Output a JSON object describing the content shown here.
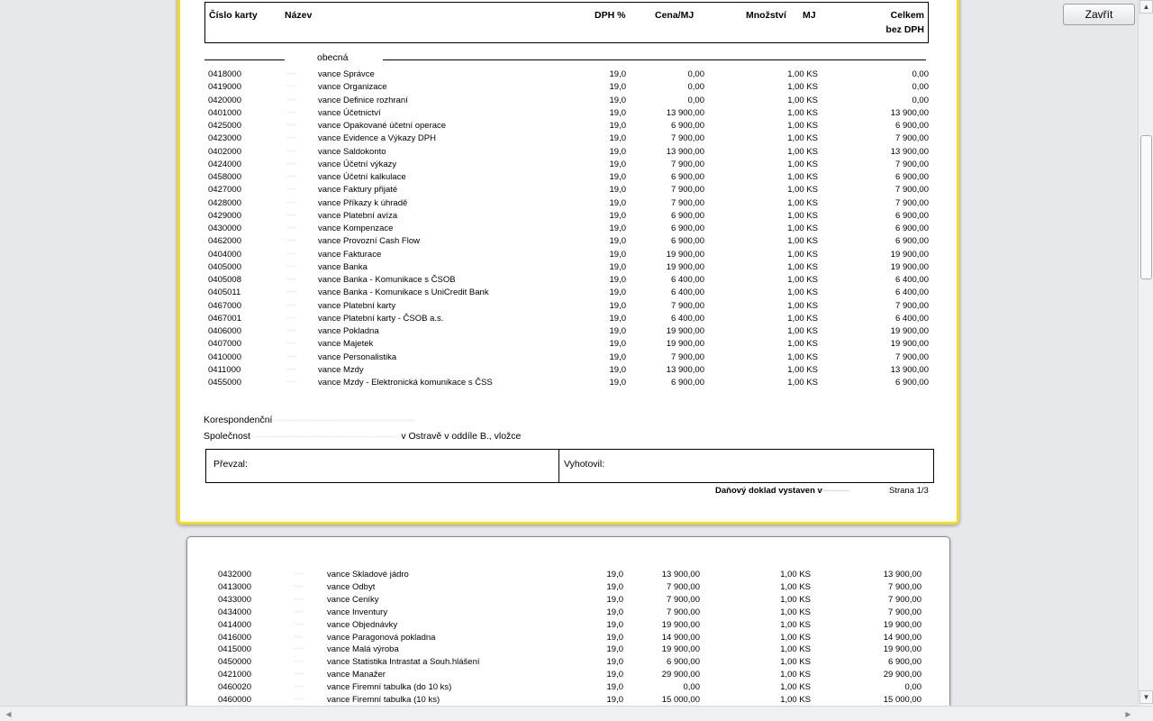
{
  "close_label": "Zavřít",
  "header": {
    "card_no": "Číslo karty",
    "name": "Název",
    "vat": "DPH %",
    "unit_price": "Cena/MJ",
    "qty": "Množství",
    "unit": "MJ",
    "total1": "Celkem",
    "total2": "bez DPH"
  },
  "group_label": "obecná",
  "rows_page1": [
    {
      "code": "0418000",
      "name": "vance Správce",
      "vat": "19,0",
      "price": "0,00",
      "qty": "1,00 KS",
      "total": "0,00"
    },
    {
      "code": "0419000",
      "name": "vance Organizace",
      "vat": "19,0",
      "price": "0,00",
      "qty": "1,00 KS",
      "total": "0,00"
    },
    {
      "code": "0420000",
      "name": "vance Definice rozhraní",
      "vat": "19,0",
      "price": "0,00",
      "qty": "1,00 KS",
      "total": "0,00"
    },
    {
      "code": "0401000",
      "name": "vance Účetnictví",
      "vat": "19,0",
      "price": "13 900,00",
      "qty": "1,00 KS",
      "total": "13 900,00"
    },
    {
      "code": "0425000",
      "name": "vance Opakované účetní operace",
      "vat": "19,0",
      "price": "6 900,00",
      "qty": "1,00 KS",
      "total": "6 900,00"
    },
    {
      "code": "0423000",
      "name": "vance Evidence a Výkazy DPH",
      "vat": "19,0",
      "price": "7 900,00",
      "qty": "1,00 KS",
      "total": "7 900,00"
    },
    {
      "code": "0402000",
      "name": "vance Saldokonto",
      "vat": "19,0",
      "price": "13 900,00",
      "qty": "1,00 KS",
      "total": "13 900,00"
    },
    {
      "code": "0424000",
      "name": "vance Účetní výkazy",
      "vat": "19,0",
      "price": "7 900,00",
      "qty": "1,00 KS",
      "total": "7 900,00"
    },
    {
      "code": "0458000",
      "name": "vance Účetní kalkulace",
      "vat": "19,0",
      "price": "6 900,00",
      "qty": "1,00 KS",
      "total": "6 900,00"
    },
    {
      "code": "0427000",
      "name": "vance Faktury přijaté",
      "vat": "19,0",
      "price": "7 900,00",
      "qty": "1,00 KS",
      "total": "7 900,00"
    },
    {
      "code": "0428000",
      "name": "vance Příkazy k úhradě",
      "vat": "19,0",
      "price": "7 900,00",
      "qty": "1,00 KS",
      "total": "7 900,00"
    },
    {
      "code": "0429000",
      "name": "vance Platební avíza",
      "vat": "19,0",
      "price": "6 900,00",
      "qty": "1,00 KS",
      "total": "6 900,00"
    },
    {
      "code": "0430000",
      "name": "vance Kompenzace",
      "vat": "19,0",
      "price": "6 900,00",
      "qty": "1,00 KS",
      "total": "6 900,00"
    },
    {
      "code": "0462000",
      "name": "vance Provozní Cash Flow",
      "vat": "19,0",
      "price": "6 900,00",
      "qty": "1,00 KS",
      "total": "6 900,00"
    },
    {
      "code": "0404000",
      "name": "vance Fakturace",
      "vat": "19,0",
      "price": "19 900,00",
      "qty": "1,00 KS",
      "total": "19 900,00"
    },
    {
      "code": "0405000",
      "name": "vance Banka",
      "vat": "19,0",
      "price": "19 900,00",
      "qty": "1,00 KS",
      "total": "19 900,00"
    },
    {
      "code": "0405008",
      "name": "vance Banka - Komunikace s ČSOB",
      "vat": "19,0",
      "price": "6 400,00",
      "qty": "1,00 KS",
      "total": "6 400,00"
    },
    {
      "code": "0405011",
      "name": "vance Banka - Komunikace s UniCredit Bank",
      "vat": "19,0",
      "price": "6 400,00",
      "qty": "1,00 KS",
      "total": "6 400,00"
    },
    {
      "code": "0467000",
      "name": "vance Platební karty",
      "vat": "19,0",
      "price": "7 900,00",
      "qty": "1,00 KS",
      "total": "7 900,00"
    },
    {
      "code": "0467001",
      "name": "vance Platební karty - ČSOB a.s.",
      "vat": "19,0",
      "price": "6 400,00",
      "qty": "1,00 KS",
      "total": "6 400,00"
    },
    {
      "code": "0406000",
      "name": "vance Pokladna",
      "vat": "19,0",
      "price": "19 900,00",
      "qty": "1,00 KS",
      "total": "19 900,00"
    },
    {
      "code": "0407000",
      "name": "vance Majetek",
      "vat": "19,0",
      "price": "19 900,00",
      "qty": "1,00 KS",
      "total": "19 900,00"
    },
    {
      "code": "0410000",
      "name": "vance Personalistika",
      "vat": "19,0",
      "price": "7 900,00",
      "qty": "1,00 KS",
      "total": "7 900,00"
    },
    {
      "code": "0411000",
      "name": "vance Mzdy",
      "vat": "19,0",
      "price": "13 900,00",
      "qty": "1,00 KS",
      "total": "13 900,00"
    },
    {
      "code": "0455000",
      "name": "vance Mzdy - Elektronická komunikace s ČSS",
      "vat": "19,0",
      "price": "6 900,00",
      "qty": "1,00 KS",
      "total": "6 900,00"
    }
  ],
  "rows_page2": [
    {
      "code": "0432000",
      "name": "vance Skladové jádro",
      "vat": "19,0",
      "price": "13 900,00",
      "qty": "1,00 KS",
      "total": "13 900,00"
    },
    {
      "code": "0413000",
      "name": "vance Odbyt",
      "vat": "19,0",
      "price": "7 900,00",
      "qty": "1,00 KS",
      "total": "7 900,00"
    },
    {
      "code": "0433000",
      "name": "vance Ceníky",
      "vat": "19,0",
      "price": "7 900,00",
      "qty": "1,00 KS",
      "total": "7 900,00"
    },
    {
      "code": "0434000",
      "name": "vance Inventury",
      "vat": "19,0",
      "price": "7 900,00",
      "qty": "1,00 KS",
      "total": "7 900,00"
    },
    {
      "code": "0414000",
      "name": "vance Objednávky",
      "vat": "19,0",
      "price": "19 900,00",
      "qty": "1,00 KS",
      "total": "19 900,00"
    },
    {
      "code": "0416000",
      "name": "vance Paragonová pokladna",
      "vat": "19,0",
      "price": "14 900,00",
      "qty": "1,00 KS",
      "total": "14 900,00"
    },
    {
      "code": "0415000",
      "name": "vance Malá výroba",
      "vat": "19,0",
      "price": "19 900,00",
      "qty": "1,00 KS",
      "total": "19 900,00"
    },
    {
      "code": "0450000",
      "name": "vance Statistika Intrastat a Souh.hlášení",
      "vat": "19,0",
      "price": "6 900,00",
      "qty": "1,00 KS",
      "total": "6 900,00"
    },
    {
      "code": "0421000",
      "name": "vance Manažer",
      "vat": "19,0",
      "price": "29 900,00",
      "qty": "1,00 KS",
      "total": "29 900,00"
    },
    {
      "code": "0460020",
      "name": "vance Firemní tabulka (do 10 ks)",
      "vat": "19,0",
      "price": "0,00",
      "qty": "1,00 KS",
      "total": "0,00"
    },
    {
      "code": "0460000",
      "name": "vance Firemní tabulka (10 ks)",
      "vat": "19,0",
      "price": "15 000,00",
      "qty": "1,00 KS",
      "total": "15 000,00"
    }
  ],
  "footer": {
    "corr": "Korespondenční",
    "company": "Společnost",
    "company_tail": "v Ostravě v oddíle B., vložce",
    "received": "Převzal:",
    "issued": "Vyhotovil:",
    "tax_doc": "Daňový doklad vystaven v",
    "page": "Strana 1/3"
  },
  "blur_prefix": "·····"
}
